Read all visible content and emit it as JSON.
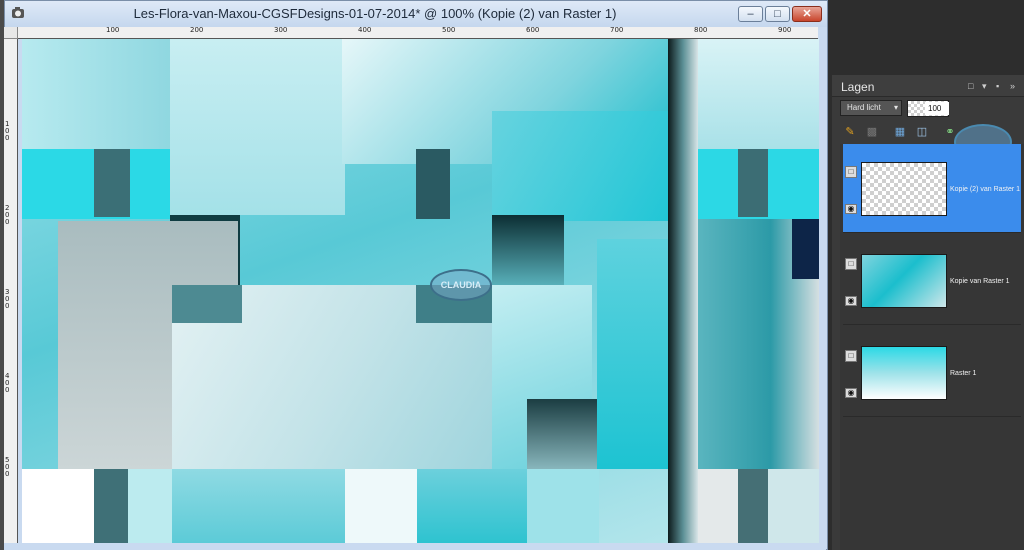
{
  "window": {
    "title": "Les-Flora-van-Maxou-CGSFDesigns-01-07-2014* @ 100% (Kopie (2) van Raster 1)",
    "minimize_label": "–",
    "maximize_label": "□",
    "close_label": "✕"
  },
  "ruler": {
    "top_ticks": [
      "100",
      "200",
      "300",
      "400",
      "500",
      "600",
      "700",
      "800",
      "900"
    ],
    "left_ticks": [
      "100",
      "200",
      "300",
      "400",
      "500"
    ]
  },
  "canvas": {
    "watermark_text": "CLAUDIA"
  },
  "layers_panel": {
    "title": "Lagen",
    "header_controls": [
      "□",
      "▾",
      "▪",
      "»"
    ],
    "blend_mode": "Hard licht",
    "opacity": "100",
    "tool_icons": [
      "brush-icon",
      "mask-icon",
      "new-layer-icon",
      "layer-effects-icon",
      "link-icon"
    ],
    "layers": [
      {
        "name": "Kopie (2) van Raster 1",
        "selected": true
      },
      {
        "name": "Kopie van Raster 1",
        "selected": false
      },
      {
        "name": "Raster 1",
        "selected": false
      }
    ]
  },
  "colors": {
    "selection": "#3b8cec",
    "panel_bg": "#3a3a3a",
    "accent_cyan": "#2bd9e6"
  }
}
